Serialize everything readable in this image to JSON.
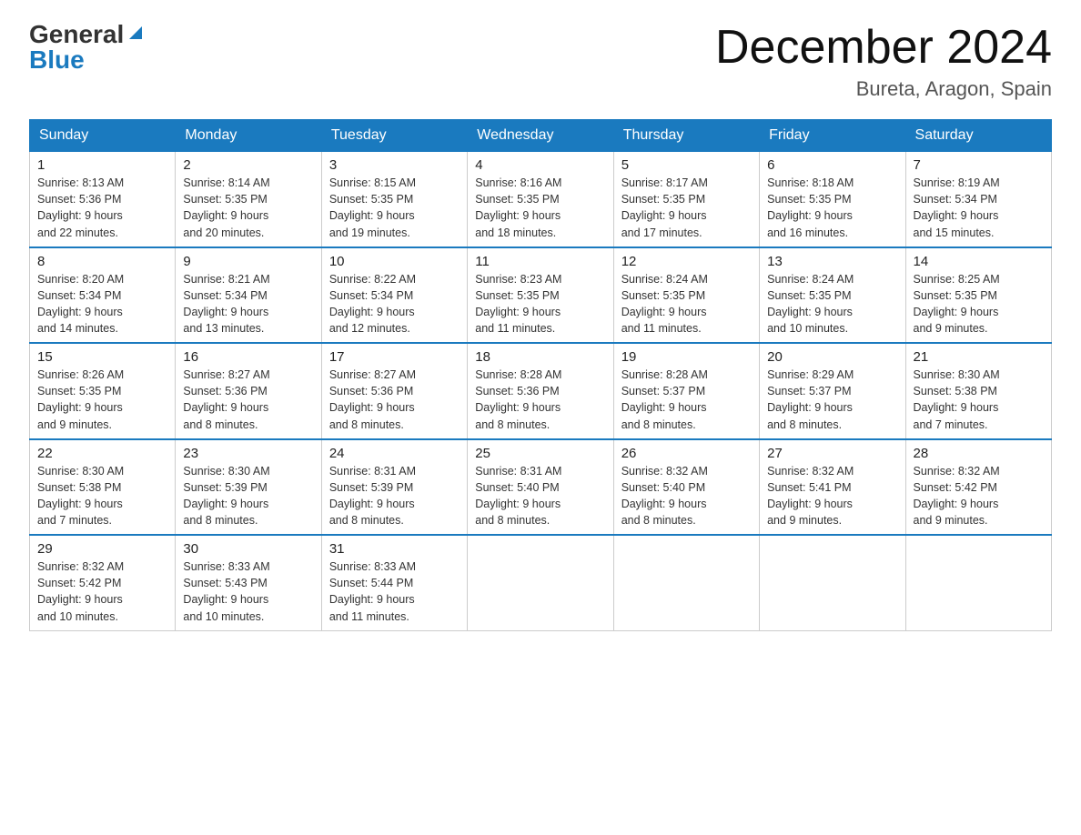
{
  "header": {
    "logo_general": "General",
    "logo_blue": "Blue",
    "month": "December 2024",
    "location": "Bureta, Aragon, Spain"
  },
  "weekdays": [
    "Sunday",
    "Monday",
    "Tuesday",
    "Wednesday",
    "Thursday",
    "Friday",
    "Saturday"
  ],
  "weeks": [
    [
      {
        "day": "1",
        "sunrise": "8:13 AM",
        "sunset": "5:36 PM",
        "daylight": "9 hours and 22 minutes."
      },
      {
        "day": "2",
        "sunrise": "8:14 AM",
        "sunset": "5:35 PM",
        "daylight": "9 hours and 20 minutes."
      },
      {
        "day": "3",
        "sunrise": "8:15 AM",
        "sunset": "5:35 PM",
        "daylight": "9 hours and 19 minutes."
      },
      {
        "day": "4",
        "sunrise": "8:16 AM",
        "sunset": "5:35 PM",
        "daylight": "9 hours and 18 minutes."
      },
      {
        "day": "5",
        "sunrise": "8:17 AM",
        "sunset": "5:35 PM",
        "daylight": "9 hours and 17 minutes."
      },
      {
        "day": "6",
        "sunrise": "8:18 AM",
        "sunset": "5:35 PM",
        "daylight": "9 hours and 16 minutes."
      },
      {
        "day": "7",
        "sunrise": "8:19 AM",
        "sunset": "5:34 PM",
        "daylight": "9 hours and 15 minutes."
      }
    ],
    [
      {
        "day": "8",
        "sunrise": "8:20 AM",
        "sunset": "5:34 PM",
        "daylight": "9 hours and 14 minutes."
      },
      {
        "day": "9",
        "sunrise": "8:21 AM",
        "sunset": "5:34 PM",
        "daylight": "9 hours and 13 minutes."
      },
      {
        "day": "10",
        "sunrise": "8:22 AM",
        "sunset": "5:34 PM",
        "daylight": "9 hours and 12 minutes."
      },
      {
        "day": "11",
        "sunrise": "8:23 AM",
        "sunset": "5:35 PM",
        "daylight": "9 hours and 11 minutes."
      },
      {
        "day": "12",
        "sunrise": "8:24 AM",
        "sunset": "5:35 PM",
        "daylight": "9 hours and 11 minutes."
      },
      {
        "day": "13",
        "sunrise": "8:24 AM",
        "sunset": "5:35 PM",
        "daylight": "9 hours and 10 minutes."
      },
      {
        "day": "14",
        "sunrise": "8:25 AM",
        "sunset": "5:35 PM",
        "daylight": "9 hours and 9 minutes."
      }
    ],
    [
      {
        "day": "15",
        "sunrise": "8:26 AM",
        "sunset": "5:35 PM",
        "daylight": "9 hours and 9 minutes."
      },
      {
        "day": "16",
        "sunrise": "8:27 AM",
        "sunset": "5:36 PM",
        "daylight": "9 hours and 8 minutes."
      },
      {
        "day": "17",
        "sunrise": "8:27 AM",
        "sunset": "5:36 PM",
        "daylight": "9 hours and 8 minutes."
      },
      {
        "day": "18",
        "sunrise": "8:28 AM",
        "sunset": "5:36 PM",
        "daylight": "9 hours and 8 minutes."
      },
      {
        "day": "19",
        "sunrise": "8:28 AM",
        "sunset": "5:37 PM",
        "daylight": "9 hours and 8 minutes."
      },
      {
        "day": "20",
        "sunrise": "8:29 AM",
        "sunset": "5:37 PM",
        "daylight": "9 hours and 8 minutes."
      },
      {
        "day": "21",
        "sunrise": "8:30 AM",
        "sunset": "5:38 PM",
        "daylight": "9 hours and 7 minutes."
      }
    ],
    [
      {
        "day": "22",
        "sunrise": "8:30 AM",
        "sunset": "5:38 PM",
        "daylight": "9 hours and 7 minutes."
      },
      {
        "day": "23",
        "sunrise": "8:30 AM",
        "sunset": "5:39 PM",
        "daylight": "9 hours and 8 minutes."
      },
      {
        "day": "24",
        "sunrise": "8:31 AM",
        "sunset": "5:39 PM",
        "daylight": "9 hours and 8 minutes."
      },
      {
        "day": "25",
        "sunrise": "8:31 AM",
        "sunset": "5:40 PM",
        "daylight": "9 hours and 8 minutes."
      },
      {
        "day": "26",
        "sunrise": "8:32 AM",
        "sunset": "5:40 PM",
        "daylight": "9 hours and 8 minutes."
      },
      {
        "day": "27",
        "sunrise": "8:32 AM",
        "sunset": "5:41 PM",
        "daylight": "9 hours and 9 minutes."
      },
      {
        "day": "28",
        "sunrise": "8:32 AM",
        "sunset": "5:42 PM",
        "daylight": "9 hours and 9 minutes."
      }
    ],
    [
      {
        "day": "29",
        "sunrise": "8:32 AM",
        "sunset": "5:42 PM",
        "daylight": "9 hours and 10 minutes."
      },
      {
        "day": "30",
        "sunrise": "8:33 AM",
        "sunset": "5:43 PM",
        "daylight": "9 hours and 10 minutes."
      },
      {
        "day": "31",
        "sunrise": "8:33 AM",
        "sunset": "5:44 PM",
        "daylight": "9 hours and 11 minutes."
      },
      null,
      null,
      null,
      null
    ]
  ],
  "labels": {
    "sunrise": "Sunrise:",
    "sunset": "Sunset:",
    "daylight": "Daylight:"
  }
}
